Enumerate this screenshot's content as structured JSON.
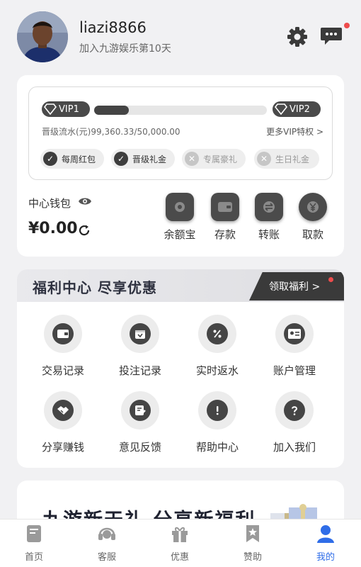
{
  "user": {
    "name": "liazi8866",
    "subtitle": "加入九游娱乐第10天"
  },
  "vip": {
    "current_label": "VIP1",
    "next_label": "VIP2",
    "progress": 0.199,
    "flow_text": "晋级流水(元)99,360.33/50,000.00",
    "more_link": "更多VIP特权 >",
    "perks": [
      {
        "label": "每周红包",
        "enabled": true
      },
      {
        "label": "晋级礼金",
        "enabled": true
      },
      {
        "label": "专属豪礼",
        "enabled": false
      },
      {
        "label": "生日礼金",
        "enabled": false
      }
    ]
  },
  "wallet": {
    "label": "中心钱包",
    "balance": "¥0.00",
    "actions": [
      {
        "label": "余额宝",
        "icon": "coin-stack-icon"
      },
      {
        "label": "存款",
        "icon": "wallet-icon"
      },
      {
        "label": "转账",
        "icon": "transfer-icon"
      },
      {
        "label": "取款",
        "icon": "yuan-icon"
      }
    ]
  },
  "welfare": {
    "title": "福利中心 尽享优惠",
    "button": "领取福利 >",
    "items": [
      {
        "label": "交易记录",
        "icon": "wallet-icon"
      },
      {
        "label": "投注记录",
        "icon": "calendar-icon"
      },
      {
        "label": "实时返水",
        "icon": "percent-icon"
      },
      {
        "label": "账户管理",
        "icon": "id-card-icon"
      },
      {
        "label": "分享赚钱",
        "icon": "handshake-icon"
      },
      {
        "label": "意见反馈",
        "icon": "edit-note-icon"
      },
      {
        "label": "帮助中心",
        "icon": "exclamation-icon"
      },
      {
        "label": "加入我们",
        "icon": "question-icon"
      }
    ]
  },
  "promo": {
    "text": "九游新天礼 分享新福利"
  },
  "tabs": [
    {
      "label": "首页",
      "icon": "home-icon"
    },
    {
      "label": "客服",
      "icon": "headset-icon"
    },
    {
      "label": "优惠",
      "icon": "gift-icon"
    },
    {
      "label": "赞助",
      "icon": "bookmark-star-icon"
    },
    {
      "label": "我的",
      "icon": "user-icon",
      "active": true
    }
  ],
  "colors": {
    "accent": "#2f6de8",
    "dark": "#3a3a3a",
    "badge": "#ee4c4c"
  }
}
